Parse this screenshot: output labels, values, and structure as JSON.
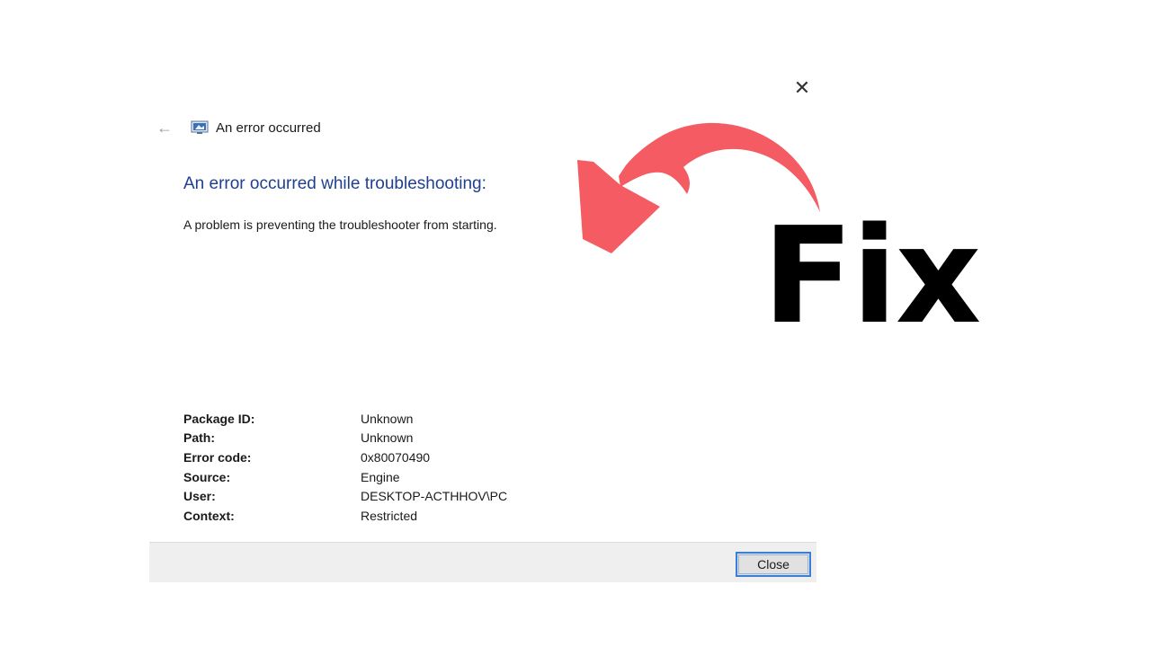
{
  "dialog": {
    "nav_title": "An error occurred",
    "heading": "An error occurred while troubleshooting:",
    "message": "A problem is preventing the troubleshooter from starting.",
    "details": [
      {
        "label": "Package ID:",
        "value": "Unknown"
      },
      {
        "label": "Path:",
        "value": "Unknown"
      },
      {
        "label": "Error code:",
        "value": "0x80070490"
      },
      {
        "label": "Source:",
        "value": "Engine"
      },
      {
        "label": "User:",
        "value": "DESKTOP-ACTHHOV\\PC"
      },
      {
        "label": "Context:",
        "value": "Restricted"
      }
    ],
    "close_button_label": "Close",
    "icons": {
      "close": "close-icon",
      "back": "back-arrow-icon",
      "app": "troubleshooter-icon"
    }
  },
  "overlay": {
    "fix_text": "Fix",
    "arrow_color": "#f45b62"
  },
  "colors": {
    "heading": "#1f3f8f",
    "button_border": "#3c7fd0",
    "footer": "#efefef"
  }
}
